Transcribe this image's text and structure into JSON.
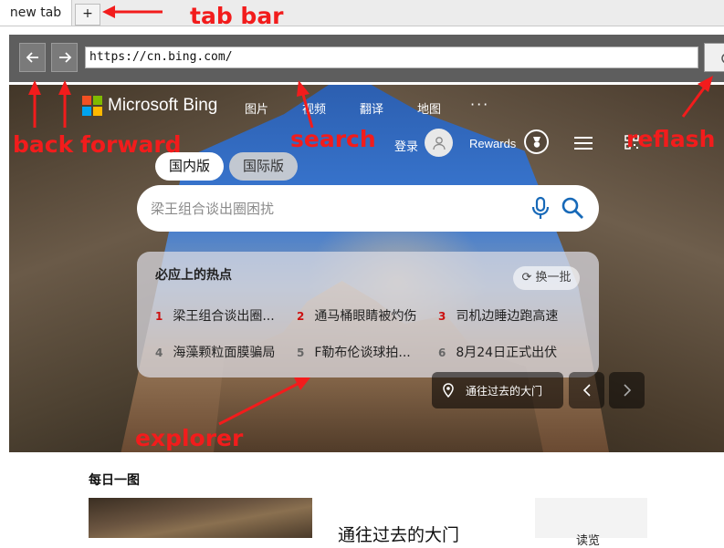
{
  "browser": {
    "tab_label": "new tab",
    "new_tab_label": "+",
    "url": "https://cn.bing.com/"
  },
  "bing": {
    "brand": "Microsoft Bing",
    "nav": [
      "图片",
      "视频",
      "翻译",
      "地图"
    ],
    "more": "···",
    "login": "登录",
    "rewards": "Rewards",
    "tabs": {
      "cn": "国内版",
      "intl": "国际版"
    },
    "search_placeholder": "梁王组合谈出圈困扰",
    "hot": {
      "title": "必应上的热点",
      "refresh": "换一批",
      "items": [
        {
          "num": "1",
          "text": "梁王组合谈出圈..."
        },
        {
          "num": "2",
          "text": "通马桶眼睛被灼伤"
        },
        {
          "num": "3",
          "text": "司机边睡边跑高速"
        },
        {
          "num": "4",
          "text": "海藻颗粒面膜骗局"
        },
        {
          "num": "5",
          "text": "F勒布伦谈球拍..."
        },
        {
          "num": "6",
          "text": "8月24日正式出伏"
        }
      ]
    },
    "image_caption": "通往过去的大门",
    "daily": {
      "title": "每日一图",
      "card_title": "通往过去的大门",
      "side": "读览"
    }
  },
  "annotations": {
    "tab_bar": "tab bar",
    "back": "back",
    "forward": "forward",
    "search": "search",
    "refresh": "reflash",
    "explorer": "explorer"
  },
  "colors": {
    "annotation": "#f21c1c",
    "hot_rank_top": "#c11",
    "toolbar": "#5e5e5e",
    "ms_red": "#f25022",
    "ms_green": "#7fba00",
    "ms_blue": "#00a4ef",
    "ms_yellow": "#ffb900"
  }
}
